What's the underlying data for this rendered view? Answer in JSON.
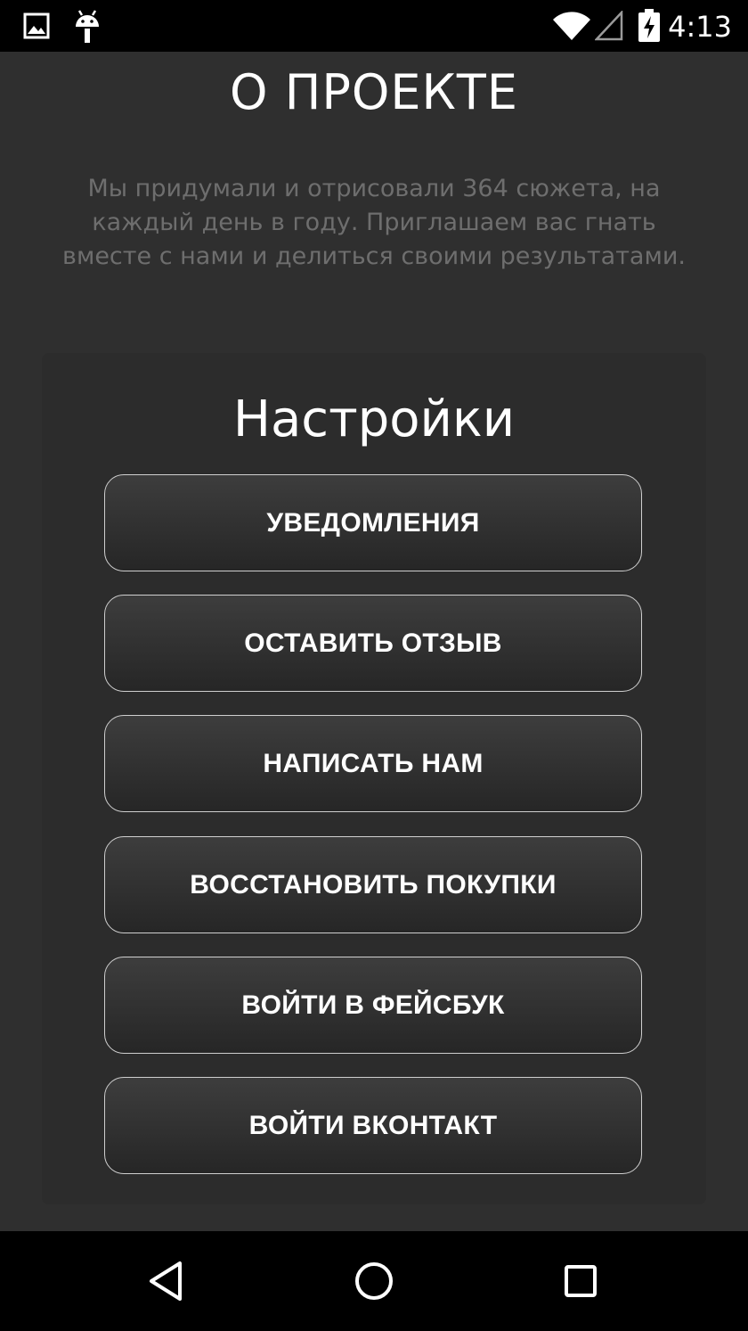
{
  "status_bar": {
    "time": "4:13",
    "icons": [
      "image-icon",
      "android-icon",
      "wifi-icon",
      "signal-icon",
      "battery-charging-icon"
    ]
  },
  "about": {
    "title": "О ПРОЕКТЕ",
    "description": "Мы придумали и отрисовали 364 сюжета, на каждый день в году. Приглашаем вас гнать вместе с нами и делиться своими результатами."
  },
  "settings": {
    "title": "Настройки",
    "buttons": {
      "notifications": "УВЕДОМЛЕНИЯ",
      "leave_review": "ОСТАВИТЬ ОТЗЫВ",
      "write_us": "НАПИСАТЬ НАМ",
      "restore_purchases": "ВОССТАНОВИТЬ ПОКУПКИ",
      "login_facebook": "ВОЙТИ В ФЕЙСБУК",
      "login_vk": "ВОЙТИ ВКОНТАКТ"
    }
  },
  "nav_bar": {
    "icons": [
      "back-icon",
      "home-icon",
      "recents-icon"
    ]
  },
  "colors": {
    "background": "#2f2f2f",
    "panel": "#2c2c2c",
    "text_primary": "#ffffff",
    "text_secondary": "#6e6e6e",
    "button_border": "#cfcfcf"
  }
}
